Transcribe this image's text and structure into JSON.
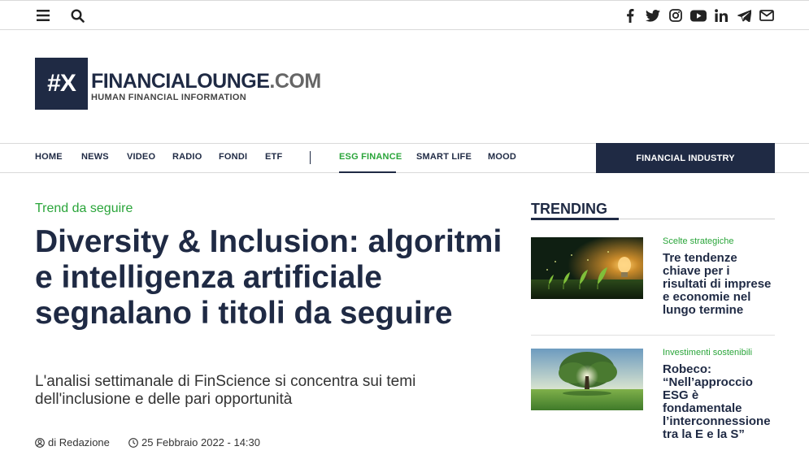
{
  "topbar": {
    "left_icons": [
      "menu-icon",
      "search-icon"
    ],
    "social_icons": [
      "facebook-icon",
      "twitter-icon",
      "instagram-icon",
      "youtube-icon",
      "linkedin-icon",
      "telegram-icon",
      "email-icon"
    ]
  },
  "logo": {
    "mark": "#X",
    "name": "FINANCIALOUNGE",
    "tld": ".COM",
    "tagline": "HUMAN FINANCIAL INFORMATION"
  },
  "nav": {
    "items": [
      "HOME",
      "NEWS",
      "VIDEO",
      "RADIO",
      "FONDI",
      "ETF"
    ],
    "secondary": [
      "ESG FINANCE",
      "SMART LIFE",
      "MOOD"
    ],
    "active": "ESG FINANCE",
    "cta": "FINANCIAL INDUSTRY"
  },
  "article": {
    "kicker": "Trend da seguire",
    "title": "Diversity & Inclusion: algoritmi e intelligenza artificiale segnalano i titoli da seguire",
    "subtitle": "L'analisi settimanale di FinScience si concentra sui temi dell'inclusione e delle pari opportunità",
    "author": "di Redazione",
    "date": "25 Febbraio 2022 - 14:30"
  },
  "trending": {
    "title": "TRENDING",
    "items": [
      {
        "category": "Scelte strategiche",
        "title": "Tre tendenze chiave per i risultati di imprese e economie nel lungo termine"
      },
      {
        "category": "Investimenti sostenibili",
        "title": "Robeco: “Nell’approccio ESG è fondamentale l’interconnessione tra la E e la S”"
      }
    ]
  },
  "colors": {
    "brand_navy": "#1f2a44",
    "accent_green": "#2aa53a"
  }
}
